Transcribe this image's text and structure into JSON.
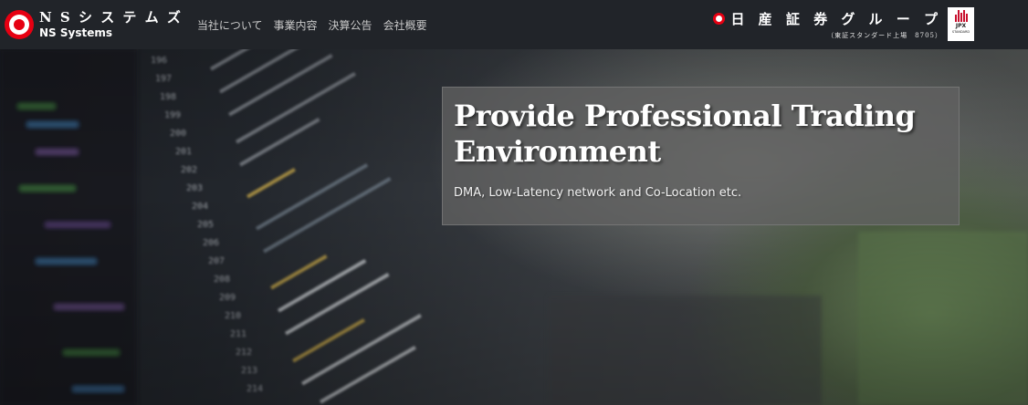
{
  "brand": {
    "name_jp": "N S シ ス テ ム ズ",
    "name_en": "NS Systems",
    "logo_color": "#e60012"
  },
  "nav": {
    "items": [
      {
        "label": "当社について"
      },
      {
        "label": "事業内容"
      },
      {
        "label": "決算公告"
      },
      {
        "label": "会社概要"
      }
    ]
  },
  "group": {
    "name": "日 産 証 券 グ ル ー プ",
    "sub": "（東証スタンダード上場　8705）",
    "mark_color": "#e60012"
  },
  "jpx": {
    "label": "JPX",
    "sub": "STANDARD",
    "bar_color": "#c8102e"
  },
  "hero": {
    "title": "Provide Professional Trading Environment",
    "subtitle": "DMA, Low-Latency network and Co-Location etc.",
    "background": "blurred-code-editor-photo",
    "accent_color": "#6f8a5d"
  }
}
